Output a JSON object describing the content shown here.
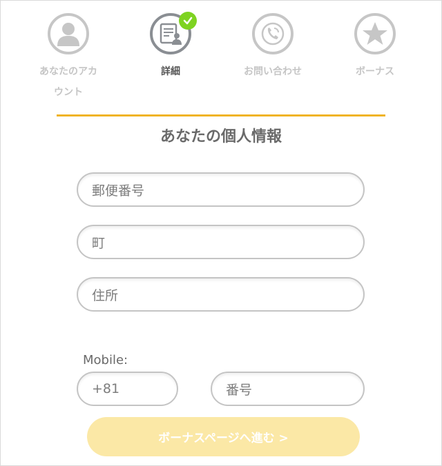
{
  "steps": [
    {
      "label": "あなたのアカ\nウント",
      "icon": "user-icon"
    },
    {
      "label": "詳細",
      "icon": "details-doc-icon"
    },
    {
      "label": "お問い合わせ",
      "icon": "phone-icon"
    },
    {
      "label": "ボーナス",
      "icon": "star-icon"
    }
  ],
  "section_title": "あなたの個人情報",
  "fields": {
    "postal_code_placeholder": "郵便番号",
    "town_placeholder": "町",
    "address_placeholder": "住所"
  },
  "mobile": {
    "label": "Mobile:",
    "country_code": "+81",
    "number_placeholder": "番号"
  },
  "cta_label": "ボーナスページへ進む >",
  "colors": {
    "accent": "#f0b323",
    "check": "#7ed321",
    "cta_bg": "#fbe8a6"
  }
}
